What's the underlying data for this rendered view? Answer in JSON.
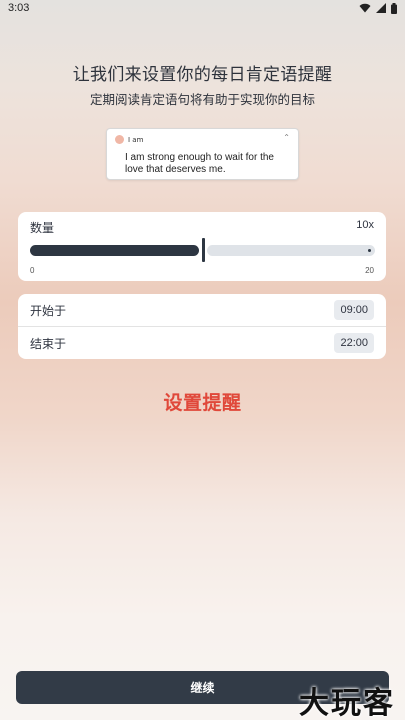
{
  "status_bar": {
    "time": "3:03",
    "icons": [
      "wifi-icon",
      "signal-icon",
      "battery-icon"
    ]
  },
  "header": {
    "title": "让我们来设置你的每日肯定语提醒",
    "subtitle": "定期阅读肯定语句将有助于实现你的目标"
  },
  "notification_preview": {
    "app_name": "I am",
    "text": "I am strong enough to wait for the love that deserves me."
  },
  "quantity": {
    "label": "数量",
    "value_text": "10x",
    "value": 10,
    "min_label": "0",
    "max_label": "20",
    "min": 0,
    "max": 20
  },
  "schedule": {
    "start_label": "开始于",
    "start_time": "09:00",
    "end_label": "结束于",
    "end_time": "22:00"
  },
  "set_reminder_label": "设置提醒",
  "continue_label": "继续",
  "watermark": "大玩客",
  "colors": {
    "accent_red": "#e0483a",
    "dark_button": "#323b47",
    "track_active": "#2d3642",
    "track_inactive": "#dfe3e8"
  }
}
